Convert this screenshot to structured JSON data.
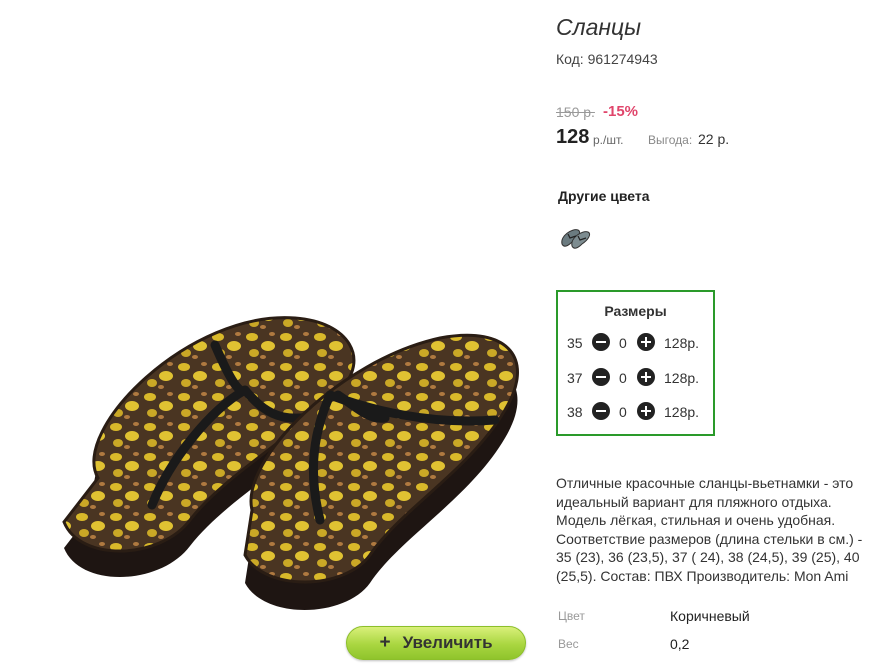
{
  "product": {
    "title": "Сланцы",
    "code": "Код: 961274943",
    "old_price": "150 р.",
    "discount": "-15%",
    "price": "128",
    "price_unit": "р./шт.",
    "benefit_label": "Выгода:",
    "benefit_value": "22 р.",
    "zoom_label": "Увеличить",
    "zoom_plus": "+"
  },
  "colors": {
    "heading": "Другие цвета",
    "swatch_icon": "flip-flops-thumbnail-icon"
  },
  "sizes": {
    "title": "Размеры",
    "rows": [
      {
        "size": "35",
        "qty": "0",
        "price": "128р."
      },
      {
        "size": "37",
        "qty": "0",
        "price": "128р."
      },
      {
        "size": "38",
        "qty": "0",
        "price": "128р."
      }
    ]
  },
  "description": "Отличные красочные сланцы-вьетнамки - это идеальный вариант для пляжного отдыха. Модель лёгкая, стильная и очень удобная. Соответствие размеров (длина стельки в см.) - 35 (23), 36 (23,5), 37 ( 24), 38 (24,5), 39 (25), 40 (25,5). Состав: ПВХ Производитель: Mon Ami",
  "attributes": [
    {
      "label": "Цвет",
      "value": "Коричневый"
    },
    {
      "label": "Вес",
      "value": "0,2"
    }
  ],
  "palette": {
    "accent_green": "#2a9a2a",
    "discount_pink": "#e0456b",
    "button_green": "#a9d640"
  }
}
